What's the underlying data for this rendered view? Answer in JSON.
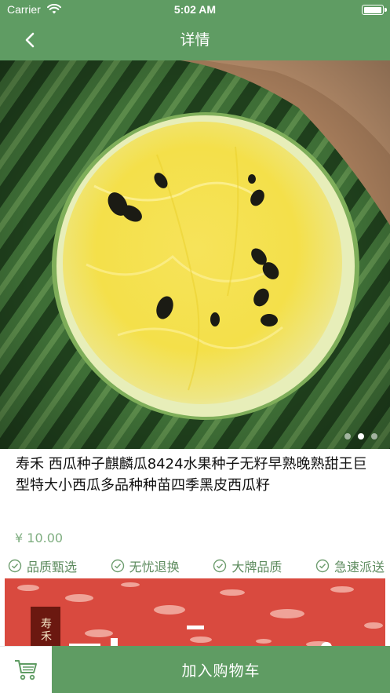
{
  "status_bar": {
    "carrier": "Carrier",
    "time": "5:02 AM",
    "battery_level": 0.95
  },
  "nav": {
    "title": "详情",
    "back_icon": "chevron-left-icon"
  },
  "hero": {
    "slide_count": 3,
    "active_slide": 2
  },
  "product": {
    "title": "寿禾 西瓜种子麒麟瓜8424水果种子无籽早熟晚熟甜王巨型特大小西瓜多品种种苗四季黑皮西瓜籽",
    "price": "¥ 10.00"
  },
  "features": [
    {
      "label": "品质甄选",
      "icon": "check-circle-icon"
    },
    {
      "label": "无忧退换",
      "icon": "check-circle-icon"
    },
    {
      "label": "大牌品质",
      "icon": "check-circle-icon"
    },
    {
      "label": "急速派送",
      "icon": "check-circle-icon"
    }
  ],
  "banner": {
    "seal_text": "寿禾"
  },
  "bottom": {
    "add_to_cart": "加入购物车",
    "cart_icon": "shopping-cart-icon"
  },
  "colors": {
    "primary": "#5f9c63",
    "price": "#7fae80",
    "feature_text": "#5e8c5f",
    "banner_red": "#d94a3f"
  }
}
